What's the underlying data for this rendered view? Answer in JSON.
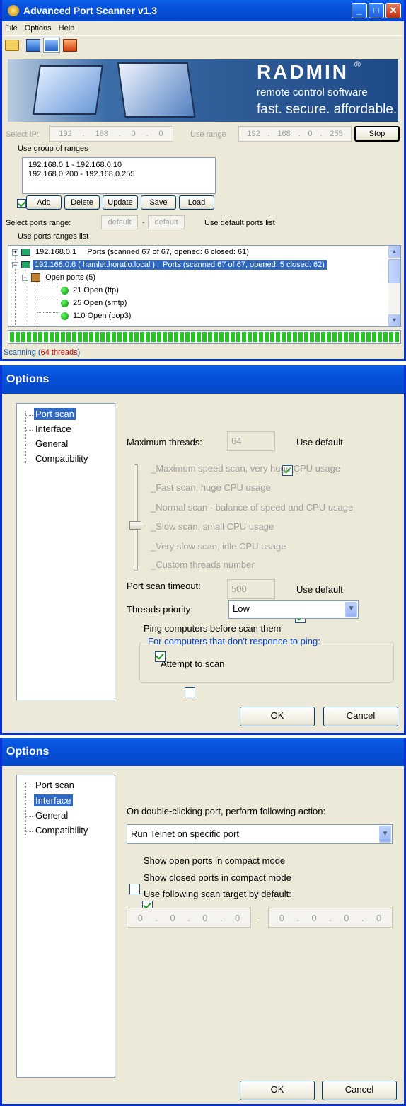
{
  "scanner": {
    "title": "Advanced Port Scanner v1.3",
    "menu": [
      "File",
      "Options",
      "Help"
    ],
    "banner": {
      "brand": "RADMIN",
      "tagline": "remote control software",
      "slogan": "fast. secure. affordable."
    },
    "select_ip_label": "Select IP:",
    "ip_from": [
      "192",
      "168",
      "0",
      "0"
    ],
    "use_range_label": "Use range",
    "ip_to": [
      "192",
      "168",
      "0",
      "255"
    ],
    "stop_label": "Stop",
    "use_group_label": "Use group of ranges",
    "ranges": [
      "192.168.0.1 - 192.168.0.10",
      "192.168.0.200 - 192.168.0.255"
    ],
    "range_buttons": [
      "Add",
      "Delete",
      "Update",
      "Save",
      "Load"
    ],
    "ports_range_label": "Select ports range:",
    "ports_from": "default",
    "ports_to": "default",
    "use_default_ports_label": "Use default ports list",
    "use_ports_ranges_label": "Use ports ranges list",
    "results": [
      {
        "ip": "192.168.0.1",
        "info": "Ports (scanned 67 of 67, opened: 6 closed: 61)"
      },
      {
        "ip": "192.168.0.6",
        "host": "( hamlet.horatio.local )",
        "info": "Ports (scanned 67 of 67, opened: 5 closed: 62)"
      }
    ],
    "open_ports_label": "Open ports (5)",
    "ports": [
      "21 Open (ftp)",
      "25 Open (smtp)",
      "110 Open (pop3)"
    ],
    "progress": 1.0,
    "status_prefix": "Scanning (",
    "status_threads": "64 threads",
    "status_suffix": ")"
  },
  "options1": {
    "title": "Options",
    "nav": [
      "Port scan",
      "Interface",
      "General",
      "Compatibility"
    ],
    "selected": "Port scan",
    "max_threads_label": "Maximum threads:",
    "max_threads_value": "64",
    "use_default_label": "Use default",
    "slider_levels": [
      "Maximum speed scan, very huge CPU usage",
      "Fast scan, huge CPU usage",
      "Normal scan - balance of speed and CPU usage",
      "Slow scan, small CPU usage",
      "Very slow scan, idle CPU usage",
      "Custom threads number"
    ],
    "slider_selected": "Slow scan, small CPU usage",
    "timeout_label": "Port scan timeout:",
    "timeout_value": "500",
    "priority_label": "Threads priority:",
    "priority_value": "Low",
    "ping_label": "Ping computers before scan them",
    "group_label": "For computers that don't responce to ping:",
    "attempt_label": "Attempt to scan",
    "ok": "OK",
    "cancel": "Cancel"
  },
  "options2": {
    "title": "Options",
    "nav": [
      "Port scan",
      "Interface",
      "General",
      "Compatibility"
    ],
    "selected": "Interface",
    "action_label": "On double-clicking port, perform following action:",
    "action_value": "Run Telnet on specific port",
    "compact_open_label": "Show open ports in compact mode",
    "compact_closed_label": "Show closed ports in compact mode",
    "target_label": "Use following scan target by default:",
    "target_from": [
      "0",
      "0",
      "0",
      "0"
    ],
    "target_to": [
      "0",
      "0",
      "0",
      "0"
    ],
    "ok": "OK",
    "cancel": "Cancel"
  },
  "colors": {
    "titlebar": "#0a5fe8",
    "face": "#ece9d8",
    "selection": "#316ac5",
    "progress": "#2bc02b",
    "threads": "#c00000"
  }
}
